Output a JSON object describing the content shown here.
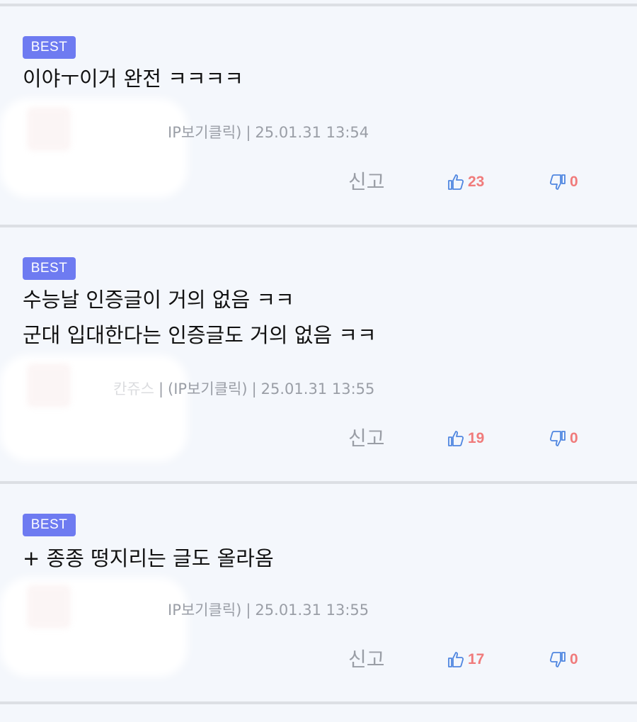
{
  "comments": [
    {
      "badge": "BEST",
      "lines": [
        "이야ㅜ이거 완전 ㅋㅋㅋㅋ"
      ],
      "author": "",
      "ip_label": "IP보기클릭)",
      "datetime": "25.01.31 13:54",
      "report": "신고",
      "likes": "23",
      "dislikes": "0"
    },
    {
      "badge": "BEST",
      "lines": [
        "수능날 인증글이 거의 없음 ㅋㅋ",
        "군대 입대한다는 인증글도 거의 없음 ㅋㅋ"
      ],
      "author": "칸쥬스",
      "ip_label": "(IP보기클릭)",
      "datetime": "25.01.31 13:55",
      "report": "신고",
      "likes": "19",
      "dislikes": "0"
    },
    {
      "badge": "BEST",
      "lines": [
        "+ 종종 떵지리는 글도 올라옴"
      ],
      "author": "",
      "ip_label": "IP보기클릭)",
      "datetime": "25.01.31 13:55",
      "report": "신고",
      "likes": "17",
      "dislikes": "0"
    }
  ],
  "colors": {
    "badge_bg": "#6e7bf1",
    "count_red": "#f07b7b",
    "thumb_blue": "#4f86e0",
    "meta_gray": "#9a9ea6",
    "background": "#f4f7fc"
  },
  "icons": {
    "like": "thumbs-up-icon",
    "dislike": "thumbs-down-icon"
  }
}
